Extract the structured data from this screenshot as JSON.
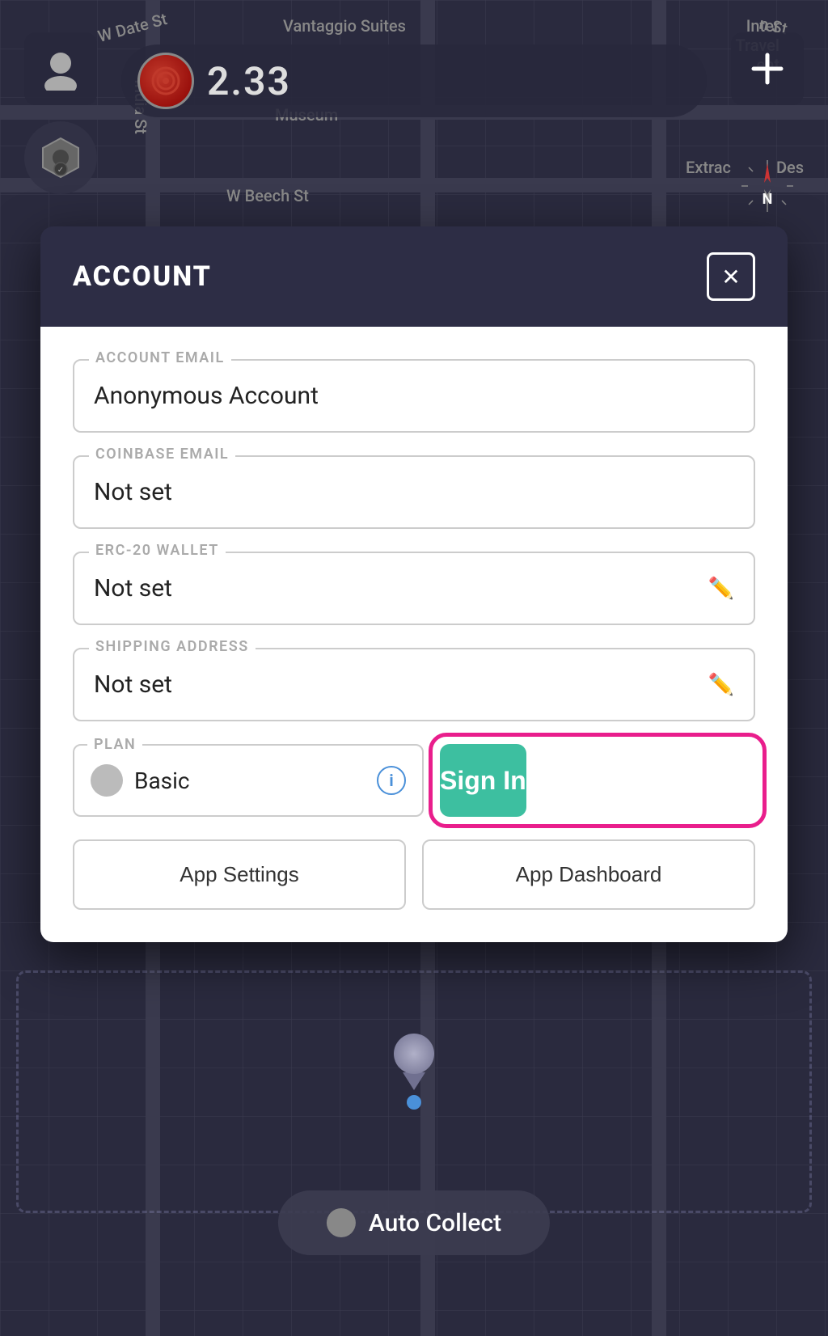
{
  "map": {
    "streets": [
      {
        "label": "W Date St",
        "class": "street-w-date"
      },
      {
        "label": "India St",
        "class": "street-india"
      },
      {
        "label": "W Beech St",
        "class": "street-w-beech"
      },
      {
        "label": "Vantaggio Suites",
        "class": "street-vantaggio"
      },
      {
        "label": "Interl Travel",
        "class": "street-inter"
      },
      {
        "label": "Extrac",
        "class": "street-extrac"
      },
      {
        "label": "Des",
        "class": "street-des"
      },
      {
        "label": "Museum",
        "class": "street-museum"
      }
    ],
    "speed": "2.33",
    "compass": "N"
  },
  "modal": {
    "title": "ACCOUNT",
    "close_label": "✕",
    "fields": {
      "account_email": {
        "label": "ACCOUNT EMAIL",
        "value": "Anonymous Account"
      },
      "coinbase_email": {
        "label": "COINBASE EMAIL",
        "value": "Not set"
      },
      "erc20_wallet": {
        "label": "ERC-20 WALLET",
        "value": "Not set"
      },
      "shipping_address": {
        "label": "SHIPPING ADDRESS",
        "value": "Not set"
      },
      "plan": {
        "label": "PLAN",
        "value": "Basic"
      }
    },
    "sign_in_label": "Sign In",
    "app_settings_label": "App Settings",
    "app_dashboard_label": "App Dashboard"
  },
  "auto_collect": {
    "label": "Auto Collect"
  },
  "colors": {
    "modal_header_bg": "#2d2d45",
    "sign_in_bg": "#3dbfa0",
    "sign_in_ring": "#e91e8c",
    "info_icon": "#4a90d9"
  }
}
